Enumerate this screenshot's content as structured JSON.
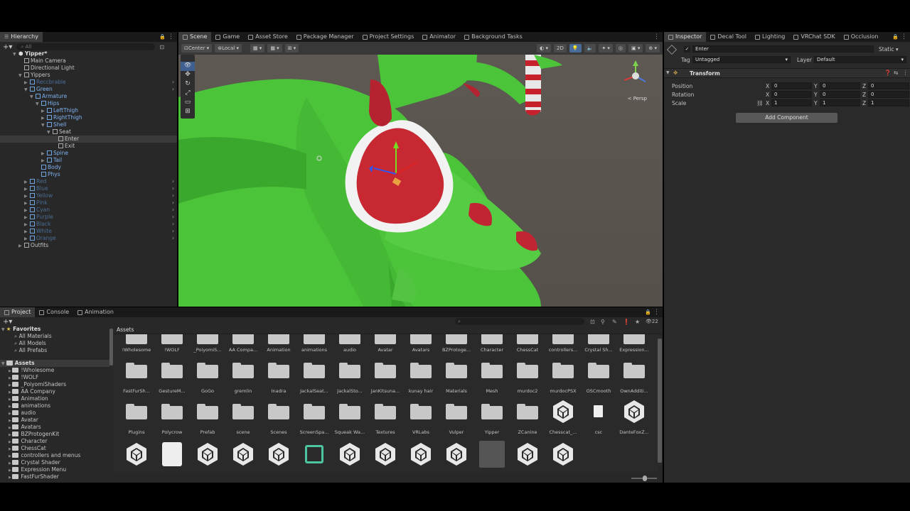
{
  "hierarchy": {
    "tab": "Hierarchy",
    "search_placeholder": "All",
    "rows": [
      {
        "label": "Yipper*",
        "indent": 0,
        "kind": "scene"
      },
      {
        "label": "Main Camera",
        "indent": 1,
        "kind": "obj"
      },
      {
        "label": "Directional Light",
        "indent": 1,
        "kind": "obj"
      },
      {
        "label": "Yippers",
        "indent": 1,
        "kind": "obj"
      },
      {
        "label": "Reccbrable",
        "indent": 2,
        "kind": "dim"
      },
      {
        "label": "Green",
        "indent": 2,
        "kind": "pref"
      },
      {
        "label": "Armature",
        "indent": 3,
        "kind": "pref"
      },
      {
        "label": "Hips",
        "indent": 4,
        "kind": "pref"
      },
      {
        "label": "LeftThigh",
        "indent": 5,
        "kind": "pref"
      },
      {
        "label": "RightThigh",
        "indent": 5,
        "kind": "pref"
      },
      {
        "label": "Shell",
        "indent": 5,
        "kind": "pref"
      },
      {
        "label": "Seat",
        "indent": 6,
        "kind": "obj"
      },
      {
        "label": "Enter",
        "indent": 7,
        "kind": "obj",
        "selected": true
      },
      {
        "label": "Exit",
        "indent": 7,
        "kind": "obj"
      },
      {
        "label": "Spine",
        "indent": 5,
        "kind": "pref"
      },
      {
        "label": "Tail",
        "indent": 5,
        "kind": "pref"
      },
      {
        "label": "Body",
        "indent": 4,
        "kind": "pref"
      },
      {
        "label": "Phys",
        "indent": 4,
        "kind": "pref"
      },
      {
        "label": "Red",
        "indent": 2,
        "kind": "dim"
      },
      {
        "label": "Blue",
        "indent": 2,
        "kind": "dim"
      },
      {
        "label": "Yellow",
        "indent": 2,
        "kind": "dim"
      },
      {
        "label": "Pink",
        "indent": 2,
        "kind": "dim"
      },
      {
        "label": "Cyan",
        "indent": 2,
        "kind": "dim"
      },
      {
        "label": "Purple",
        "indent": 2,
        "kind": "dim"
      },
      {
        "label": "Black",
        "indent": 2,
        "kind": "dim"
      },
      {
        "label": "White",
        "indent": 2,
        "kind": "dim"
      },
      {
        "label": "Orange",
        "indent": 2,
        "kind": "dim"
      },
      {
        "label": "Outfits",
        "indent": 1,
        "kind": "obj"
      }
    ]
  },
  "scene_tabs": [
    "Scene",
    "Game",
    "Asset Store",
    "Package Manager",
    "Project Settings",
    "Animator",
    "Background Tasks"
  ],
  "scene_toolbar": {
    "pivot": "Center",
    "space": "Local",
    "mode2d": "2D",
    "persp": "< Persp"
  },
  "inspector": {
    "tabs": [
      "Inspector",
      "Decal Tool",
      "Lighting",
      "VRChat SDK",
      "Occlusion"
    ],
    "object_name": "Enter",
    "static_label": "Static",
    "tag_label": "Tag",
    "tag_value": "Untagged",
    "layer_label": "Layer",
    "layer_value": "Default",
    "component": "Transform",
    "position_label": "Position",
    "rotation_label": "Rotation",
    "scale_label": "Scale",
    "position": [
      "0",
      "0",
      "0"
    ],
    "rotation": [
      "0",
      "0",
      "0"
    ],
    "scale": [
      "1",
      "1",
      "1"
    ],
    "axis": [
      "X",
      "Y",
      "Z"
    ],
    "add_component": "Add Component"
  },
  "project": {
    "tabs": [
      "Project",
      "Console",
      "Animation"
    ],
    "badge": "22",
    "breadcrumb": "Assets",
    "favorites_label": "Favorites",
    "favorites": [
      "All Materials",
      "All Models",
      "All Prefabs"
    ],
    "assets_label": "Assets",
    "tree": [
      "!Wholesome",
      "!WOLF",
      "_PoiyomiShaders",
      "AA Company",
      "Animation",
      "animations",
      "audio",
      "Avatar",
      "Avatars",
      "BZProtogenKit",
      "Character",
      "ChessCat",
      "controllers and menus",
      "Crystal Shader",
      "Expression Menu",
      "FastFurShader"
    ],
    "grid_row1": [
      "!Wholesome",
      "!WOLF",
      "_PoiyomiS...",
      "AA Compa...",
      "Animation",
      "animations",
      "audio",
      "Avatar",
      "Avatars",
      "BZProtoge...",
      "Character",
      "ChessCat",
      "controllers...",
      "Crystal Sh...",
      "Expression..."
    ],
    "grid_row2": [
      "FastFurSh...",
      "GestureM...",
      "GoGo",
      "gremlin",
      "Inadra",
      "JackalSeat...",
      "JackalSto...",
      "JanKitsuna...",
      "kunay hair",
      "Materials",
      "Mesh",
      "murdoc2",
      "murdocPSX",
      "OSCmooth",
      "OwnAdditi..."
    ],
    "grid_row3": [
      "Plugins",
      "Polycrow",
      "Prefab",
      "scene",
      "Scenes",
      "ScreenSpa...",
      "Squeak Wa...",
      "Textures",
      "VRLabs",
      "Vulper",
      "Yipper",
      "ZCanine",
      "Chesscat_...",
      "csc",
      "DanteFoxZ..."
    ]
  }
}
